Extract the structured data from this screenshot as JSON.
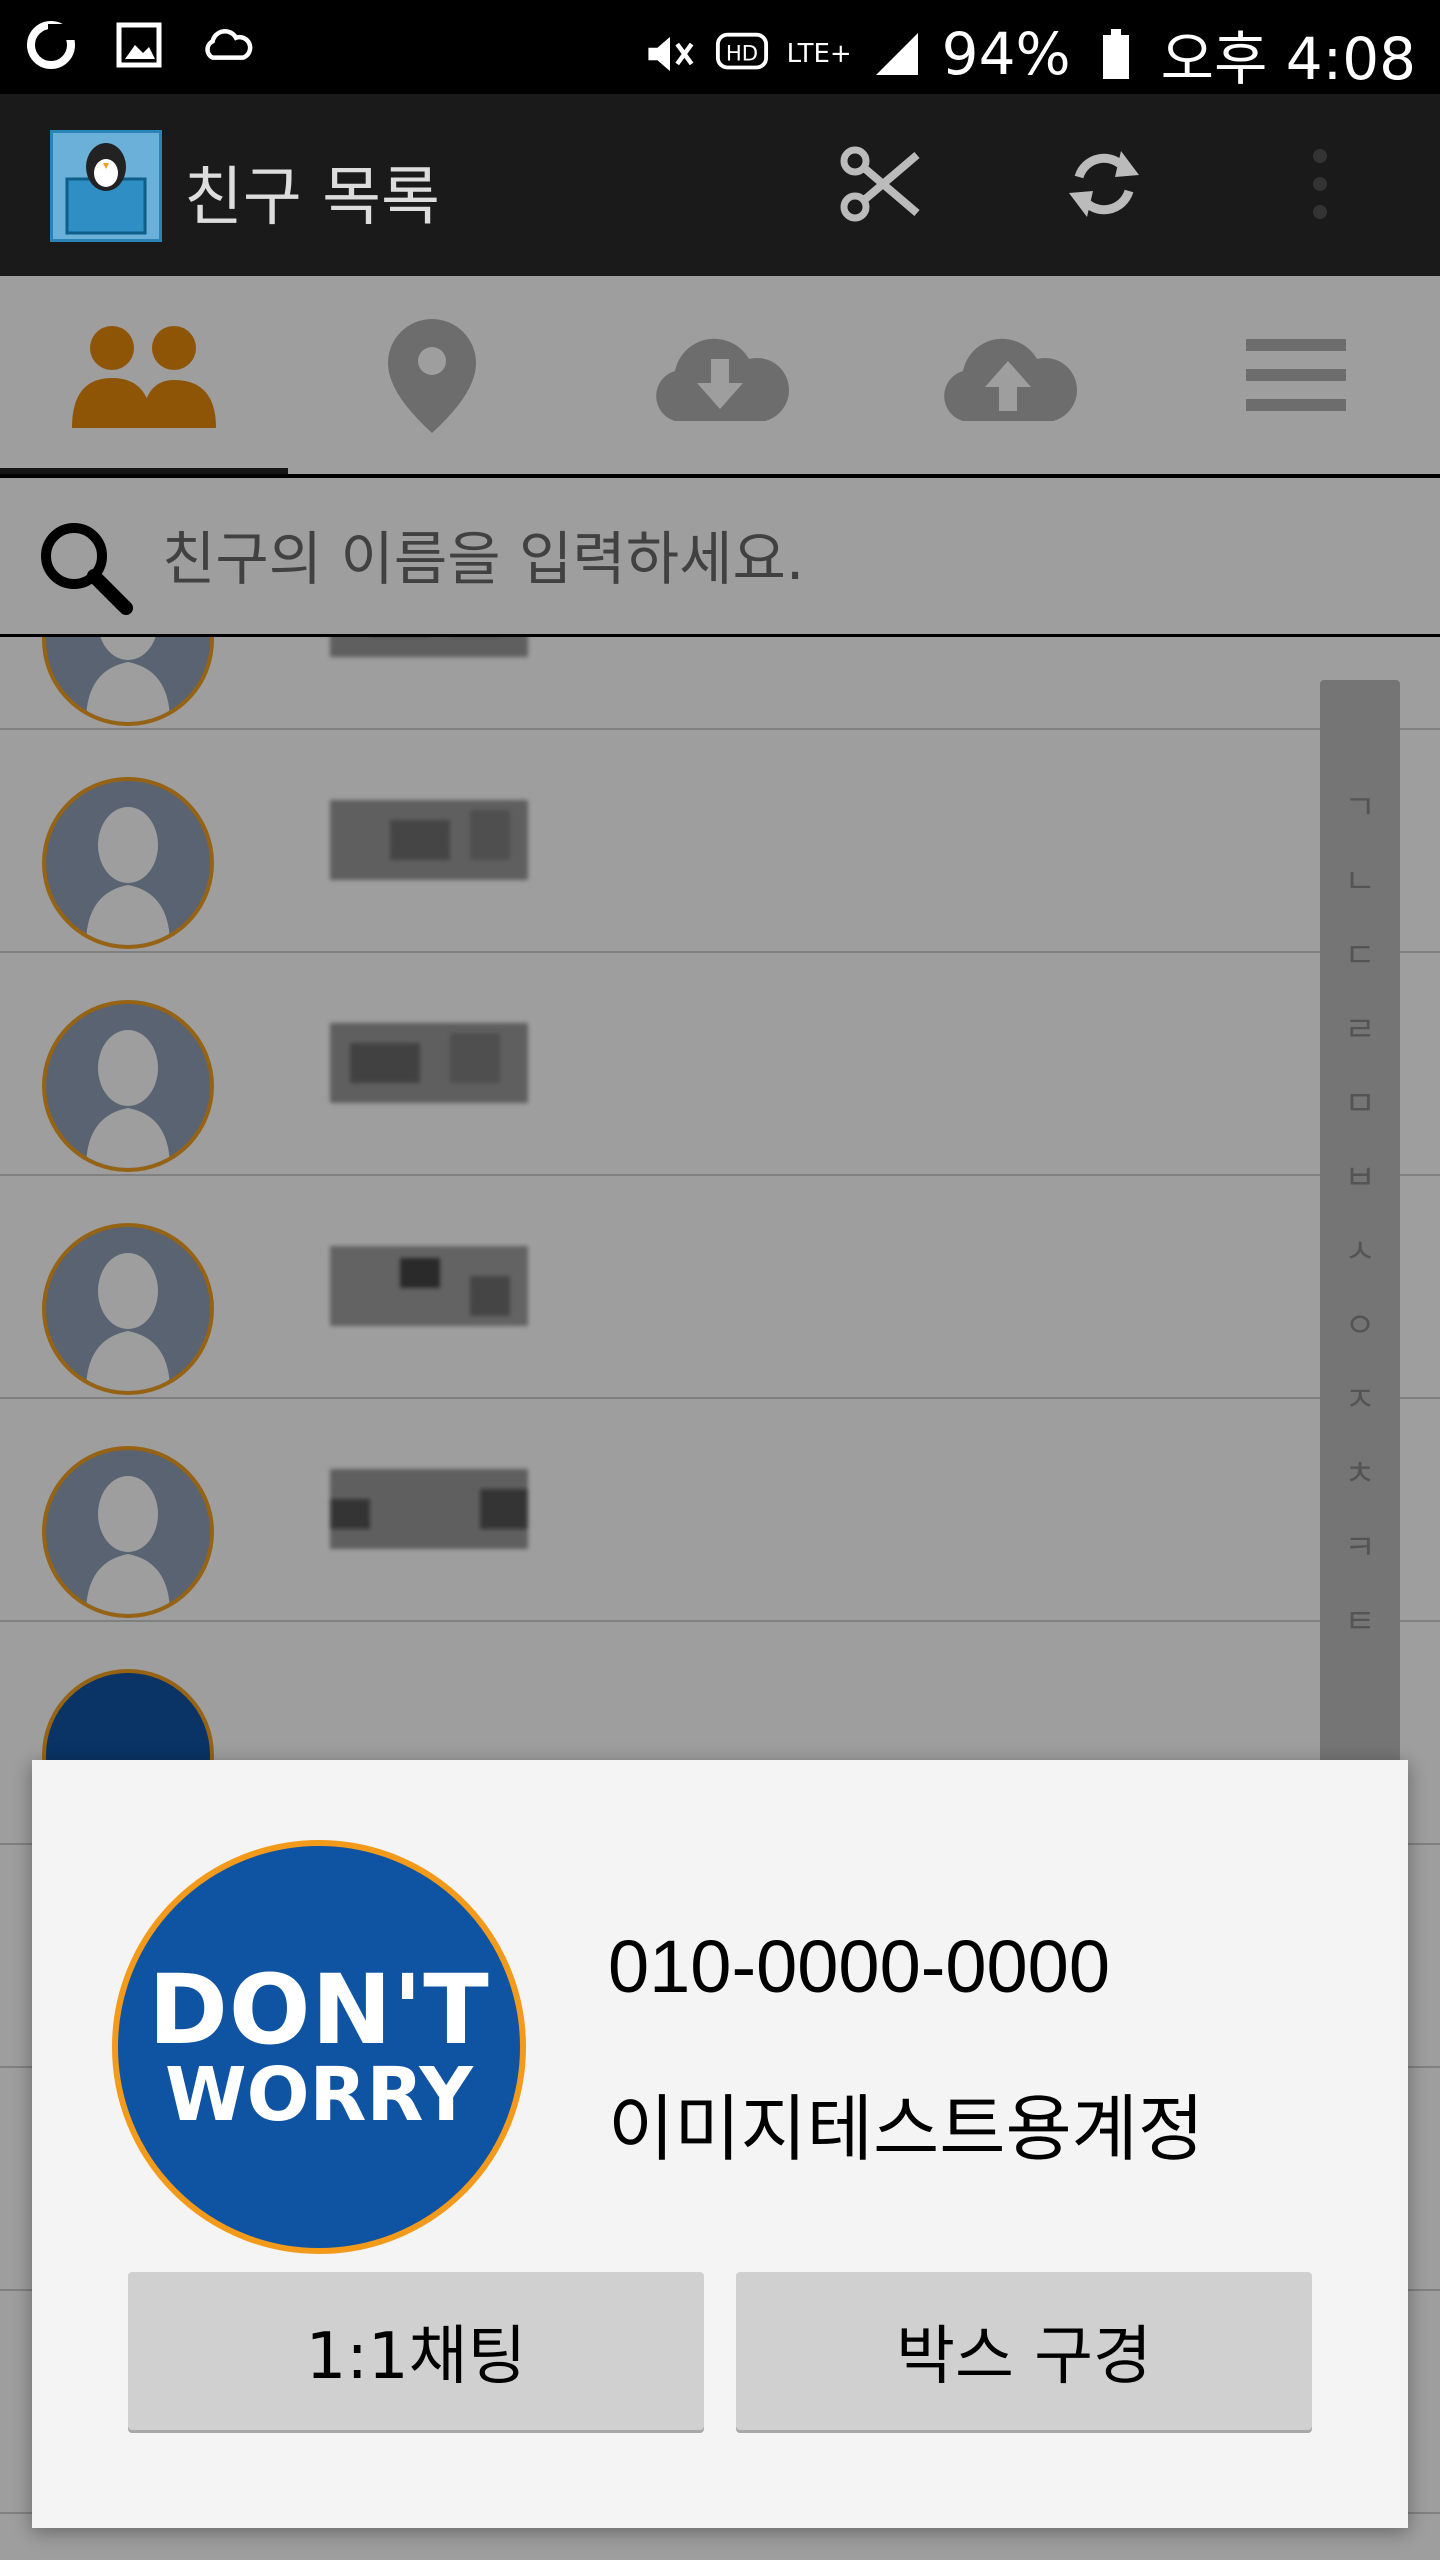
{
  "status_bar": {
    "battery": "94%",
    "time": "오후 4:08",
    "network": "LTE+",
    "hd_label": "HD"
  },
  "app_bar": {
    "title": "친구 목록"
  },
  "tabs": [
    {
      "name": "friends",
      "icon": "people-icon",
      "active": true
    },
    {
      "name": "location",
      "icon": "location-pin-icon",
      "active": false
    },
    {
      "name": "download",
      "icon": "cloud-download-icon",
      "active": false
    },
    {
      "name": "upload",
      "icon": "cloud-upload-icon",
      "active": false
    },
    {
      "name": "menu",
      "icon": "menu-icon",
      "active": false
    }
  ],
  "search": {
    "placeholder": "친구의 이름을 입력하세요."
  },
  "index_letters": [
    "ㄱ",
    "ㄴ",
    "ㄷ",
    "ㄹ",
    "ㅁ",
    "ㅂ",
    "ㅅ",
    "ㅇ",
    "ㅈ",
    "ㅊ",
    "ㅋ",
    "ㅌ"
  ],
  "dialog": {
    "phone": "010-0000-0000",
    "name": "이미지테스트용계정",
    "avatar_logo_line1": "DON'T",
    "avatar_logo_line2": "WORRY",
    "button_chat": "1:1채팅",
    "button_box": "박스 구경"
  },
  "colors": {
    "accent": "#f0a020",
    "logo_bg": "#0f54a3"
  }
}
